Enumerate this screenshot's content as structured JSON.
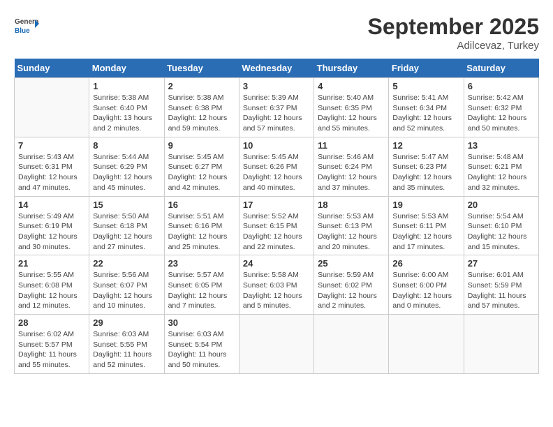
{
  "header": {
    "logo_general": "General",
    "logo_blue": "Blue",
    "month": "September 2025",
    "location": "Adilcevaz, Turkey"
  },
  "days_of_week": [
    "Sunday",
    "Monday",
    "Tuesday",
    "Wednesday",
    "Thursday",
    "Friday",
    "Saturday"
  ],
  "weeks": [
    [
      {
        "day": "",
        "info": ""
      },
      {
        "day": "1",
        "info": "Sunrise: 5:38 AM\nSunset: 6:40 PM\nDaylight: 13 hours\nand 2 minutes."
      },
      {
        "day": "2",
        "info": "Sunrise: 5:38 AM\nSunset: 6:38 PM\nDaylight: 12 hours\nand 59 minutes."
      },
      {
        "day": "3",
        "info": "Sunrise: 5:39 AM\nSunset: 6:37 PM\nDaylight: 12 hours\nand 57 minutes."
      },
      {
        "day": "4",
        "info": "Sunrise: 5:40 AM\nSunset: 6:35 PM\nDaylight: 12 hours\nand 55 minutes."
      },
      {
        "day": "5",
        "info": "Sunrise: 5:41 AM\nSunset: 6:34 PM\nDaylight: 12 hours\nand 52 minutes."
      },
      {
        "day": "6",
        "info": "Sunrise: 5:42 AM\nSunset: 6:32 PM\nDaylight: 12 hours\nand 50 minutes."
      }
    ],
    [
      {
        "day": "7",
        "info": "Sunrise: 5:43 AM\nSunset: 6:31 PM\nDaylight: 12 hours\nand 47 minutes."
      },
      {
        "day": "8",
        "info": "Sunrise: 5:44 AM\nSunset: 6:29 PM\nDaylight: 12 hours\nand 45 minutes."
      },
      {
        "day": "9",
        "info": "Sunrise: 5:45 AM\nSunset: 6:27 PM\nDaylight: 12 hours\nand 42 minutes."
      },
      {
        "day": "10",
        "info": "Sunrise: 5:45 AM\nSunset: 6:26 PM\nDaylight: 12 hours\nand 40 minutes."
      },
      {
        "day": "11",
        "info": "Sunrise: 5:46 AM\nSunset: 6:24 PM\nDaylight: 12 hours\nand 37 minutes."
      },
      {
        "day": "12",
        "info": "Sunrise: 5:47 AM\nSunset: 6:23 PM\nDaylight: 12 hours\nand 35 minutes."
      },
      {
        "day": "13",
        "info": "Sunrise: 5:48 AM\nSunset: 6:21 PM\nDaylight: 12 hours\nand 32 minutes."
      }
    ],
    [
      {
        "day": "14",
        "info": "Sunrise: 5:49 AM\nSunset: 6:19 PM\nDaylight: 12 hours\nand 30 minutes."
      },
      {
        "day": "15",
        "info": "Sunrise: 5:50 AM\nSunset: 6:18 PM\nDaylight: 12 hours\nand 27 minutes."
      },
      {
        "day": "16",
        "info": "Sunrise: 5:51 AM\nSunset: 6:16 PM\nDaylight: 12 hours\nand 25 minutes."
      },
      {
        "day": "17",
        "info": "Sunrise: 5:52 AM\nSunset: 6:15 PM\nDaylight: 12 hours\nand 22 minutes."
      },
      {
        "day": "18",
        "info": "Sunrise: 5:53 AM\nSunset: 6:13 PM\nDaylight: 12 hours\nand 20 minutes."
      },
      {
        "day": "19",
        "info": "Sunrise: 5:53 AM\nSunset: 6:11 PM\nDaylight: 12 hours\nand 17 minutes."
      },
      {
        "day": "20",
        "info": "Sunrise: 5:54 AM\nSunset: 6:10 PM\nDaylight: 12 hours\nand 15 minutes."
      }
    ],
    [
      {
        "day": "21",
        "info": "Sunrise: 5:55 AM\nSunset: 6:08 PM\nDaylight: 12 hours\nand 12 minutes."
      },
      {
        "day": "22",
        "info": "Sunrise: 5:56 AM\nSunset: 6:07 PM\nDaylight: 12 hours\nand 10 minutes."
      },
      {
        "day": "23",
        "info": "Sunrise: 5:57 AM\nSunset: 6:05 PM\nDaylight: 12 hours\nand 7 minutes."
      },
      {
        "day": "24",
        "info": "Sunrise: 5:58 AM\nSunset: 6:03 PM\nDaylight: 12 hours\nand 5 minutes."
      },
      {
        "day": "25",
        "info": "Sunrise: 5:59 AM\nSunset: 6:02 PM\nDaylight: 12 hours\nand 2 minutes."
      },
      {
        "day": "26",
        "info": "Sunrise: 6:00 AM\nSunset: 6:00 PM\nDaylight: 12 hours\nand 0 minutes."
      },
      {
        "day": "27",
        "info": "Sunrise: 6:01 AM\nSunset: 5:59 PM\nDaylight: 11 hours\nand 57 minutes."
      }
    ],
    [
      {
        "day": "28",
        "info": "Sunrise: 6:02 AM\nSunset: 5:57 PM\nDaylight: 11 hours\nand 55 minutes."
      },
      {
        "day": "29",
        "info": "Sunrise: 6:03 AM\nSunset: 5:55 PM\nDaylight: 11 hours\nand 52 minutes."
      },
      {
        "day": "30",
        "info": "Sunrise: 6:03 AM\nSunset: 5:54 PM\nDaylight: 11 hours\nand 50 minutes."
      },
      {
        "day": "",
        "info": ""
      },
      {
        "day": "",
        "info": ""
      },
      {
        "day": "",
        "info": ""
      },
      {
        "day": "",
        "info": ""
      }
    ]
  ]
}
